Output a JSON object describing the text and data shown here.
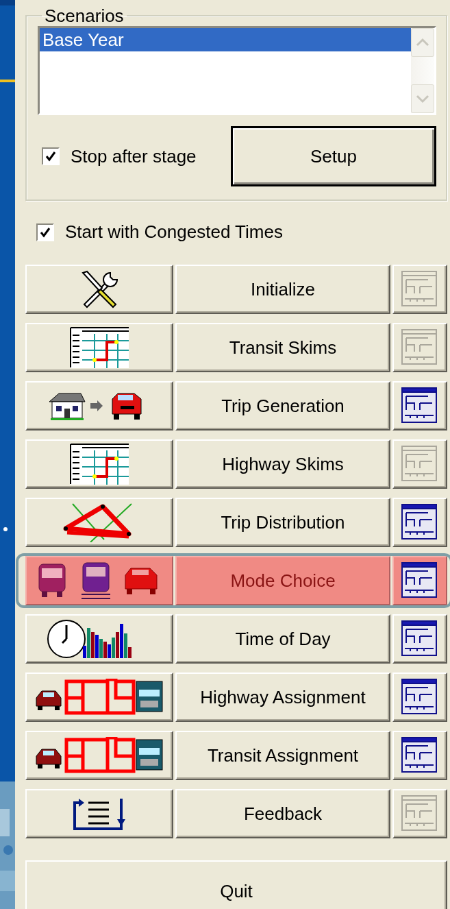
{
  "scenarios": {
    "title": "Scenarios",
    "items": [
      {
        "label": "Base Year",
        "selected": true
      }
    ],
    "stop_after_stage": {
      "label": "Stop after stage",
      "checked": true
    },
    "setup_button": "Setup"
  },
  "congested": {
    "label": "Start with Congested Times",
    "checked": true
  },
  "stages": [
    {
      "kind": "tools",
      "label": "Initialize",
      "report_disabled": true,
      "selected": false
    },
    {
      "kind": "grid",
      "label": "Transit Skims",
      "report_disabled": true,
      "selected": false
    },
    {
      "kind": "house-car",
      "label": "Trip Generation",
      "report_disabled": false,
      "selected": false
    },
    {
      "kind": "grid",
      "label": "Highway Skims",
      "report_disabled": true,
      "selected": false
    },
    {
      "kind": "triangle",
      "label": "Trip Distribution",
      "report_disabled": false,
      "selected": false
    },
    {
      "kind": "vehicles",
      "label": "Mode Choice",
      "report_disabled": false,
      "selected": true
    },
    {
      "kind": "clock-bars",
      "label": "Time of Day",
      "report_disabled": false,
      "selected": false
    },
    {
      "kind": "network",
      "label": "Highway Assignment",
      "report_disabled": false,
      "selected": false
    },
    {
      "kind": "network",
      "label": "Transit Assignment",
      "report_disabled": false,
      "selected": false
    },
    {
      "kind": "feedback",
      "label": "Feedback",
      "report_disabled": true,
      "selected": false
    }
  ],
  "quit_button": "Quit"
}
